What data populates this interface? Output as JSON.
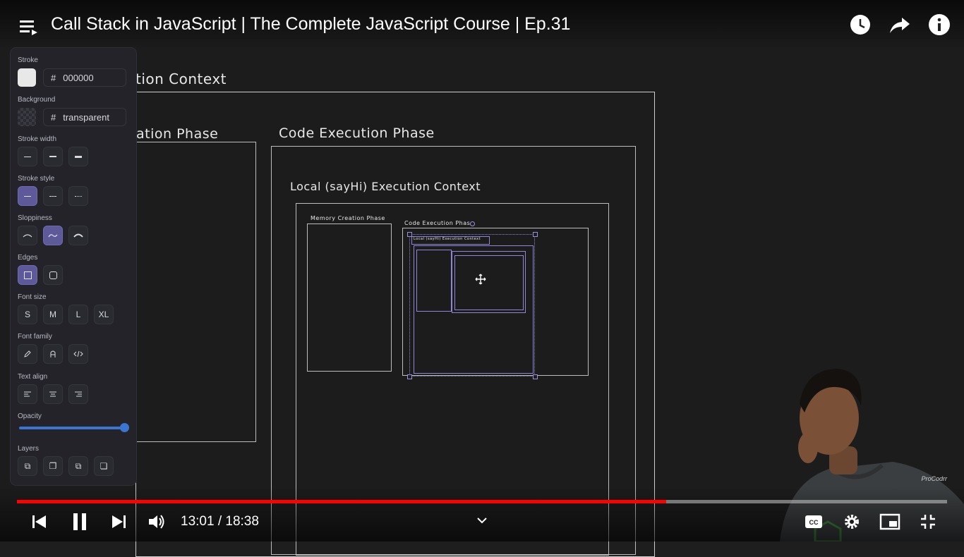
{
  "video": {
    "title": "Call Stack in JavaScript | The Complete JavaScript Course | Ep.31",
    "time_current": "13:01",
    "time_separator": " / ",
    "time_total": "18:38",
    "progress_fraction": 0.698,
    "channel_watermark": "ProCodrr"
  },
  "panel": {
    "stroke_label": "Stroke",
    "stroke_hash": "#",
    "stroke_value": "000000",
    "background_label": "Background",
    "background_hash": "#",
    "background_value": "transparent",
    "stroke_width_label": "Stroke width",
    "stroke_style_label": "Stroke style",
    "sloppiness_label": "Sloppiness",
    "edges_label": "Edges",
    "font_size_label": "Font size",
    "font_sizes": [
      "S",
      "M",
      "L",
      "XL"
    ],
    "font_family_label": "Font family",
    "text_align_label": "Text align",
    "opacity_label": "Opacity",
    "opacity_value": 1,
    "layers_label": "Layers"
  },
  "canvas": {
    "global_context": "tion Context",
    "memory_phase_outer": "ation Phase",
    "code_phase_outer": "Code Execution Phase",
    "local_context": "Local (sayHi) Execution Context",
    "inner_memory_phase": "Memory Creation Phase",
    "inner_code_phase": "Code Execution Phase",
    "inner_local_context": "Local (sayHi) Execution Context"
  },
  "colors": {
    "accent": "#5e5a9a",
    "selection": "#8f86d6",
    "progress": "#ff0000",
    "slider": "#3a75d1"
  },
  "icons": {
    "top_right": [
      "watch-later-icon",
      "share-icon",
      "info-icon"
    ],
    "controls": [
      "previous-icon",
      "pause-icon",
      "next-icon",
      "volume-icon",
      "chevron-down-icon",
      "captions-icon",
      "settings-icon",
      "miniplayer-icon",
      "exit-fullscreen-icon"
    ]
  }
}
